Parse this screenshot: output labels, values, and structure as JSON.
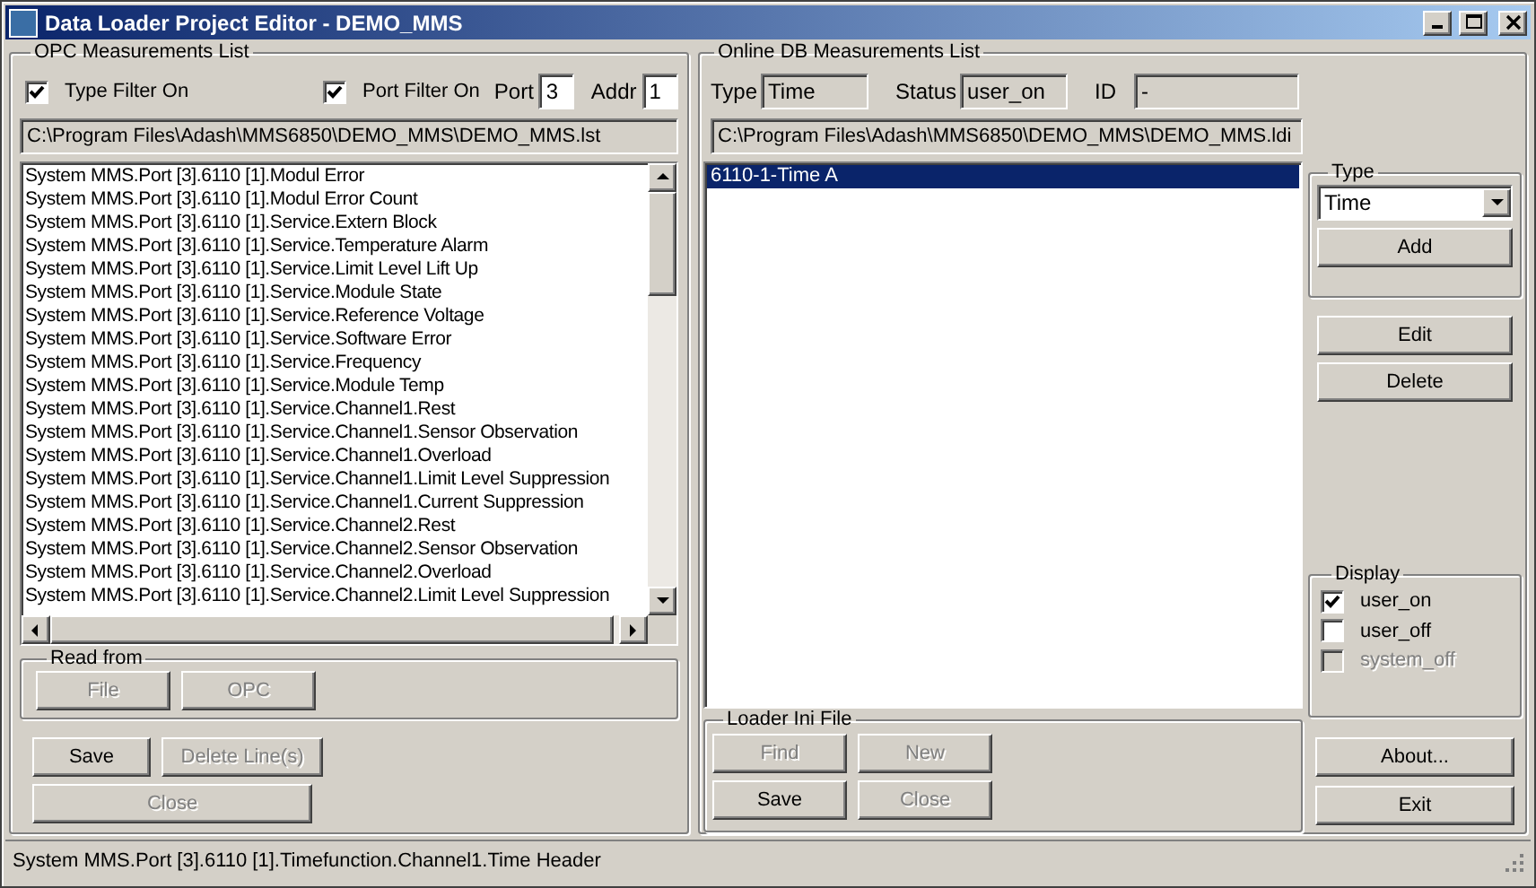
{
  "window": {
    "title": "Data Loader Project Editor - DEMO_MMS"
  },
  "opc": {
    "title": "OPC Measurements List",
    "type_filter": {
      "label": "Type Filter On",
      "checked": true
    },
    "port_filter": {
      "label": "Port Filter On",
      "checked": true
    },
    "port": {
      "label": "Port",
      "value": "3"
    },
    "addr": {
      "label": "Addr",
      "value": "1"
    },
    "path": "C:\\Program Files\\Adash\\MMS6850\\DEMO_MMS\\DEMO_MMS.lst",
    "items": [
      "System MMS.Port [3].6110 [1].Modul Error",
      "System MMS.Port [3].6110 [1].Modul Error Count",
      "System MMS.Port [3].6110 [1].Service.Extern Block",
      "System MMS.Port [3].6110 [1].Service.Temperature Alarm",
      "System MMS.Port [3].6110 [1].Service.Limit Level Lift Up",
      "System MMS.Port [3].6110 [1].Service.Module State",
      "System MMS.Port [3].6110 [1].Service.Reference Voltage",
      "System MMS.Port [3].6110 [1].Service.Software Error",
      "System MMS.Port [3].6110 [1].Service.Frequency",
      "System MMS.Port [3].6110 [1].Service.Module Temp",
      "System MMS.Port [3].6110 [1].Service.Channel1.Rest",
      "System MMS.Port [3].6110 [1].Service.Channel1.Sensor Observation",
      "System MMS.Port [3].6110 [1].Service.Channel1.Overload",
      "System MMS.Port [3].6110 [1].Service.Channel1.Limit Level Suppression",
      "System MMS.Port [3].6110 [1].Service.Channel1.Current Suppression",
      "System MMS.Port [3].6110 [1].Service.Channel2.Rest",
      "System MMS.Port [3].6110 [1].Service.Channel2.Sensor Observation",
      "System MMS.Port [3].6110 [1].Service.Channel2.Overload",
      "System MMS.Port [3].6110 [1].Service.Channel2.Limit Level Suppression"
    ],
    "read_from": {
      "title": "Read from",
      "buttons": [
        {
          "label": "File",
          "disabled": true
        },
        {
          "label": "OPC",
          "disabled": true
        }
      ]
    },
    "buttons": [
      {
        "label": "Save",
        "disabled": false
      },
      {
        "label": "Delete Line(s)",
        "disabled": true
      },
      {
        "label": "Close",
        "disabled": true
      }
    ]
  },
  "online": {
    "title": "Online DB Measurements List",
    "type": {
      "label": "Type",
      "value": "Time"
    },
    "status": {
      "label": "Status",
      "value": "user_on"
    },
    "id": {
      "label": "ID",
      "value": "-"
    },
    "path": "C:\\Program Files\\Adash\\MMS6850\\DEMO_MMS\\DEMO_MMS.ldi",
    "items": [
      {
        "label": "6110-1-Time A",
        "selected": true
      }
    ],
    "type_group": {
      "title": "Type",
      "value": "Time",
      "add": {
        "label": "Add",
        "disabled": false
      }
    },
    "buttons": [
      {
        "label": "Edit",
        "disabled": false
      },
      {
        "label": "Delete",
        "disabled": false
      }
    ],
    "display": {
      "title": "Display",
      "options": [
        {
          "label": "user_on",
          "checked": true,
          "disabled": false
        },
        {
          "label": "user_off",
          "checked": false,
          "disabled": false
        },
        {
          "label": "system_off",
          "checked": false,
          "disabled": true
        }
      ]
    },
    "loader": {
      "title": "Loader Ini File",
      "buttons": [
        {
          "label": "Find",
          "disabled": true
        },
        {
          "label": "New",
          "disabled": true
        },
        {
          "label": "Save",
          "disabled": false
        },
        {
          "label": "Close",
          "disabled": true
        }
      ]
    },
    "about": {
      "label": "About...",
      "disabled": false
    },
    "exit": {
      "label": "Exit",
      "disabled": false
    }
  },
  "status_bar": {
    "text": "System MMS.Port [3].6110 [1].Timefunction.Channel1.Time Header"
  }
}
